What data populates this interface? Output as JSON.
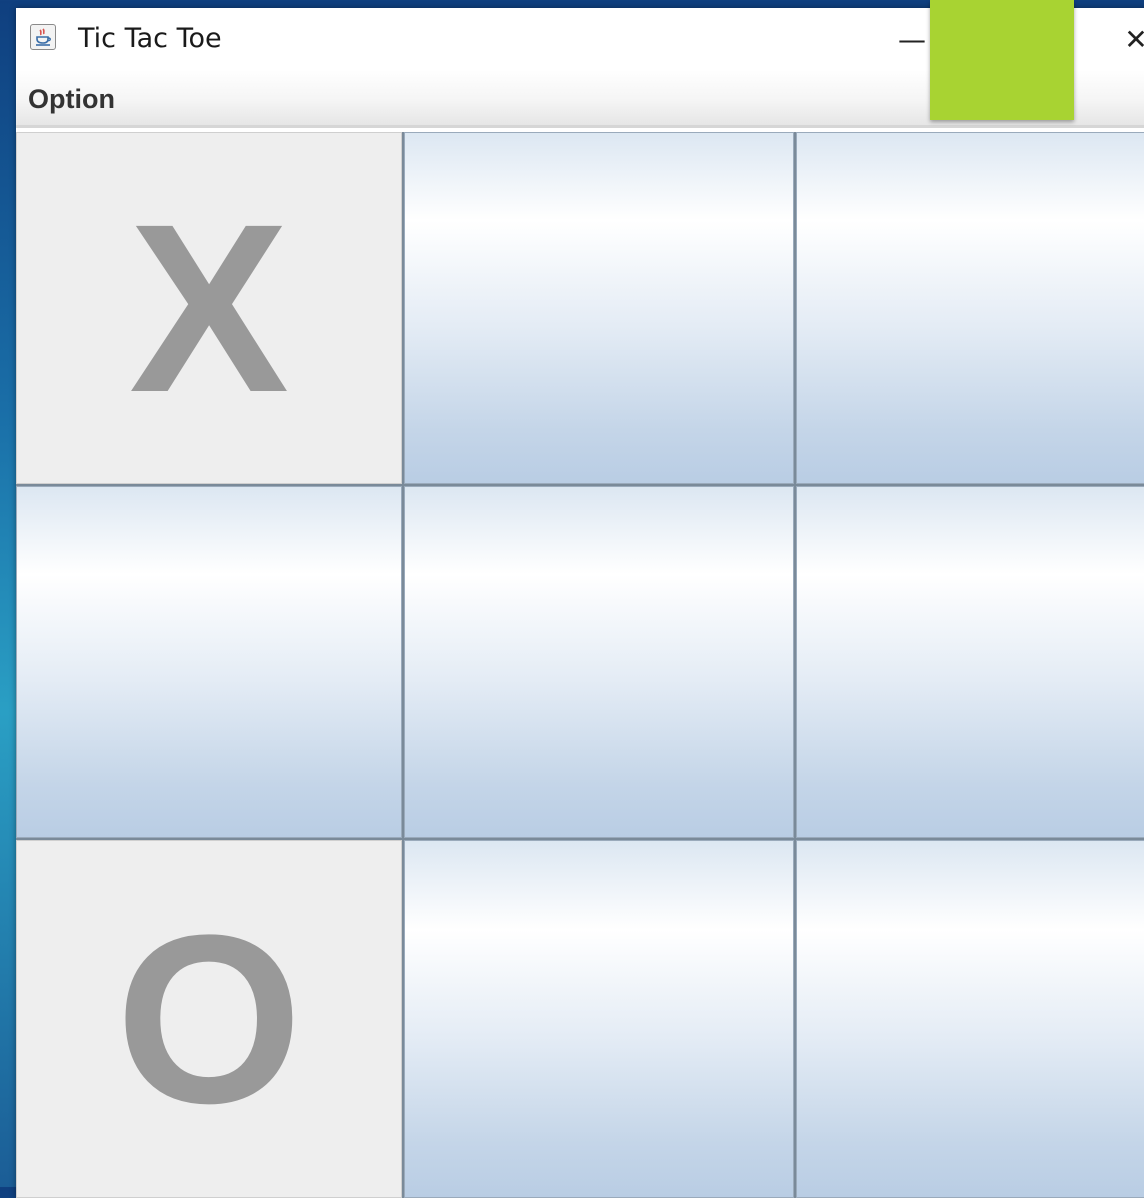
{
  "window": {
    "title": "Tic Tac Toe",
    "minimize_glyph": "—",
    "close_glyph": "✕"
  },
  "menubar": {
    "items": [
      {
        "label": "Option"
      }
    ]
  },
  "board": {
    "cells": [
      {
        "mark": "X"
      },
      {
        "mark": ""
      },
      {
        "mark": ""
      },
      {
        "mark": ""
      },
      {
        "mark": ""
      },
      {
        "mark": ""
      },
      {
        "mark": "O"
      },
      {
        "mark": ""
      },
      {
        "mark": ""
      }
    ]
  },
  "colors": {
    "overlay": "#a8d332",
    "mark": "#999999"
  }
}
